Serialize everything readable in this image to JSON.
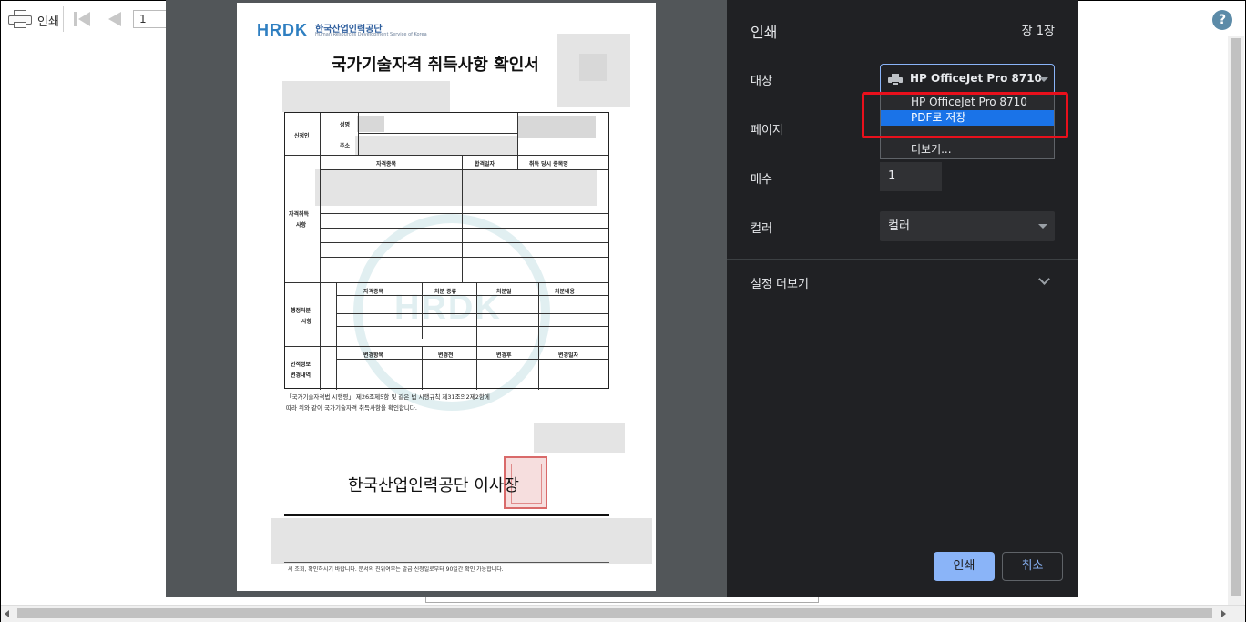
{
  "viewer": {
    "print_label": "인쇄",
    "page_number": "1",
    "help_glyph": "?"
  },
  "dialog": {
    "title": "인쇄",
    "page_count": "장 1장",
    "destination": {
      "label": "대상",
      "selected": "HP OfficeJet Pro 8710",
      "options": [
        "HP OfficeJet Pro 8710",
        "PDF로 저장",
        "더보기..."
      ],
      "highlighted_option": "PDF로 저장"
    },
    "pages": {
      "label": "페이지"
    },
    "copies": {
      "label": "매수",
      "value": "1"
    },
    "color": {
      "label": "컬러",
      "value": "컬러"
    },
    "more_settings": "설정 더보기",
    "print_button": "인쇄",
    "cancel_button": "취소",
    "accent_color": "#8ab4f8",
    "highlight_box_color": "#e8101c"
  },
  "document": {
    "logo": "HRDK",
    "org_name": "한국산업인력공단",
    "org_sub": "Human Resources Development Service of Korea",
    "title": "국가기술자격 취득사항 확인서",
    "applicant_label": "신청인",
    "name_label": "성명",
    "address_label": "주소",
    "qual_section_label": [
      "자격취득",
      "사항"
    ],
    "qual_headers": [
      "자격종목",
      "합격일자",
      "취득 당시 종목명"
    ],
    "admin_section_label": [
      "행정처분",
      "사항"
    ],
    "admin_headers": [
      "자격종목",
      "처분 종류",
      "처분일",
      "처분내용"
    ],
    "personal_section_label": [
      "인적정보",
      "변경내역"
    ],
    "personal_headers": [
      "변경항목",
      "변경전",
      "변경후",
      "변경일자"
    ],
    "note_line1": "「국가기술자격법 시행령」 제26조제5항 및 같은 법 시행규칙 제31조의2제2항에",
    "note_line2": "따라 위와 같이 국가기술자격 취득사항을 확인합니다.",
    "signature": "한국산업인력공단 이사장",
    "footer": "서 조회, 확인하시기 바랍니다.  문서의 진위여부는 발급 신청일로부터 90일간 확인 가능합니다."
  }
}
